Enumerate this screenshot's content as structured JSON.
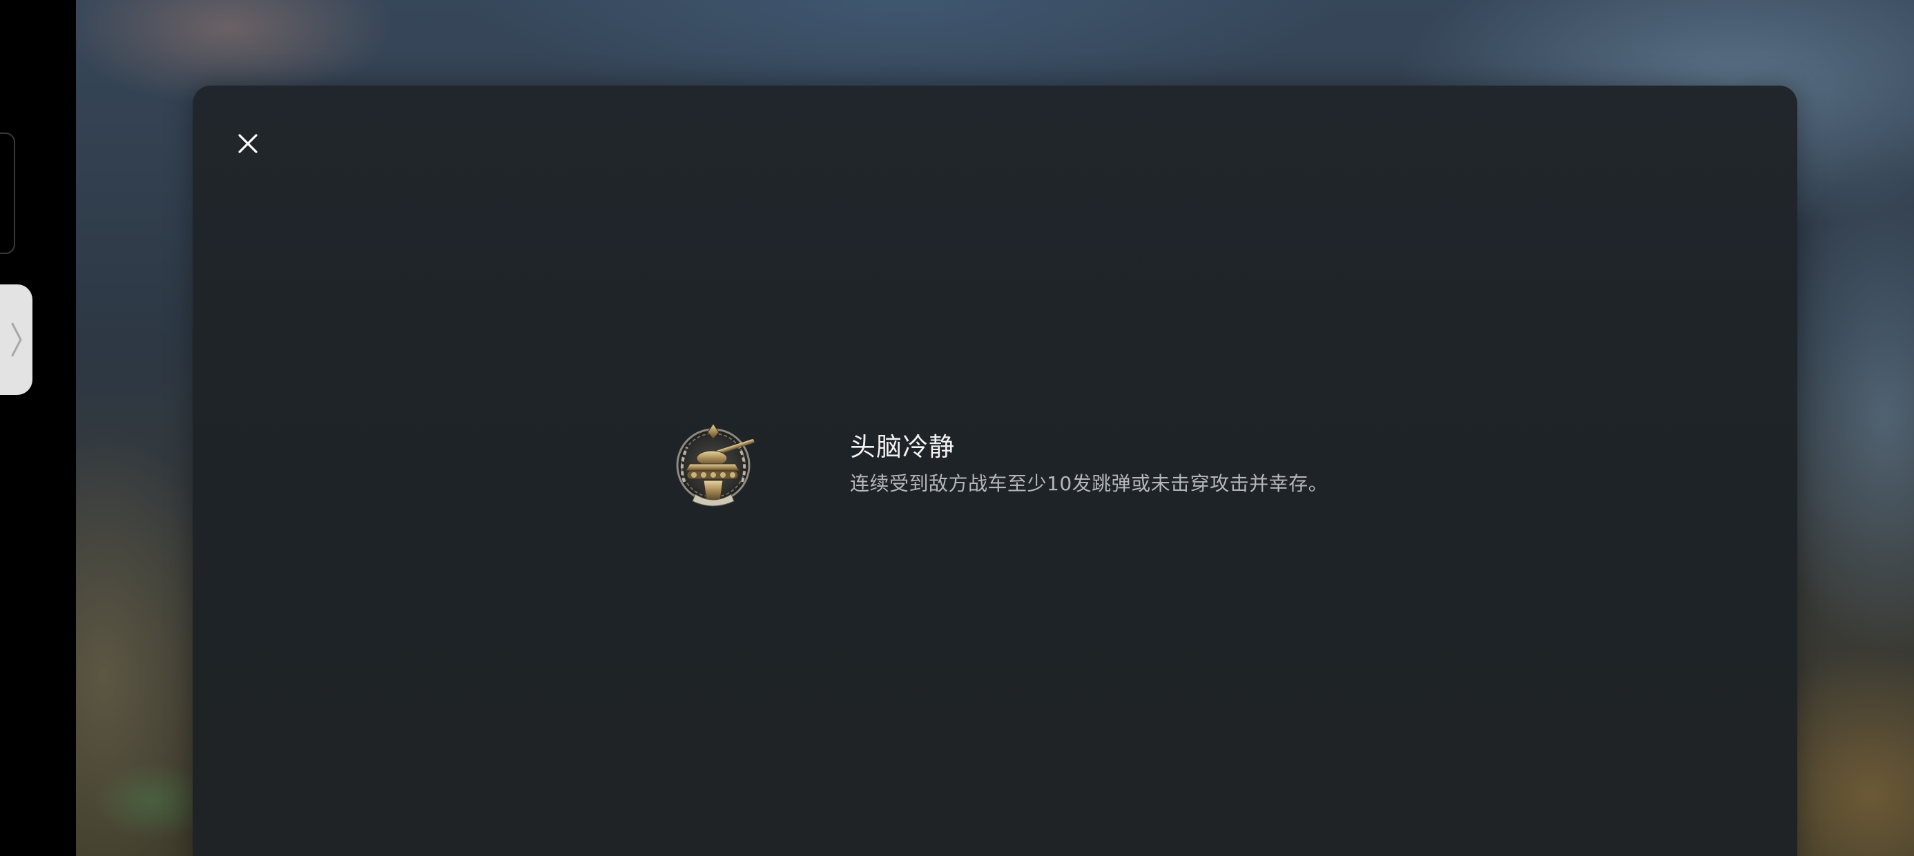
{
  "achievement": {
    "title": "头脑冷静",
    "description": "连续受到敌方战车至少10发跳弹或未击穿攻击并幸存。",
    "medal_icon": "tank-medal-icon"
  },
  "controls": {
    "close_icon": "close-icon",
    "sidebar_toggle_icon": "chevron-right-icon"
  },
  "colors": {
    "modal_background": "#1f2428",
    "title_text": "#f2f2f2",
    "description_text": "#b4b8bb",
    "sidebar_tab": "#e3e3e3"
  }
}
